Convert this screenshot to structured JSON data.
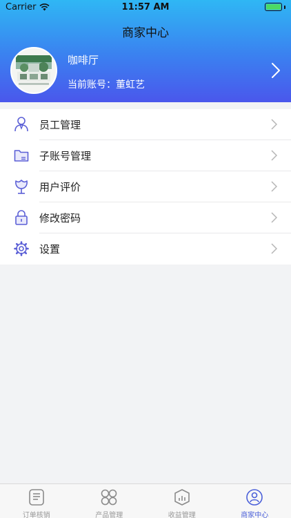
{
  "status_bar": {
    "carrier": "Carrier",
    "time": "11:57 AM"
  },
  "nav": {
    "title": "商家中心"
  },
  "profile": {
    "shop_name": "咖啡厅",
    "account_prefix": "当前账号：",
    "account_name": "董虹艺"
  },
  "menu": {
    "items": [
      {
        "label": "员工管理",
        "icon": "staff-icon"
      },
      {
        "label": "子账号管理",
        "icon": "folder-icon"
      },
      {
        "label": "用户评价",
        "icon": "review-flower-icon"
      },
      {
        "label": "修改密码",
        "icon": "lock-icon"
      },
      {
        "label": "设置",
        "icon": "gear-icon"
      }
    ]
  },
  "tabbar": {
    "active_index": 3,
    "active_color": "#4a5fd9",
    "tabs": [
      {
        "label": "订单核销",
        "icon": "order-icon"
      },
      {
        "label": "产品管理",
        "icon": "grid-icon"
      },
      {
        "label": "收益管理",
        "icon": "chart-icon"
      },
      {
        "label": "商家中心",
        "icon": "user-circle-icon"
      }
    ]
  },
  "colors": {
    "header_gradient_top": "#2fb7f4",
    "header_gradient_bottom": "#4a57ec",
    "icon_purple": "#5b5fd6"
  }
}
